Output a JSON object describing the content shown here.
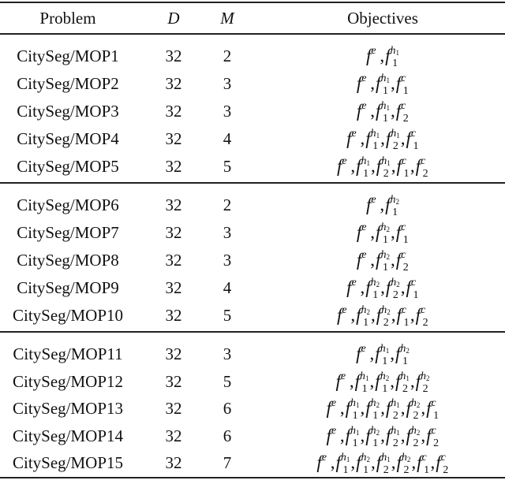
{
  "table": {
    "headers": {
      "problem": "Problem",
      "d": "D",
      "m": "M",
      "objectives": "Objectives"
    },
    "groups": [
      {
        "rows": [
          {
            "problem": "CitySeg/MOP1",
            "d": "32",
            "m": "2",
            "objectives": [
              {
                "sup": "e"
              },
              {
                "sup": "h",
                "supsub": "1",
                "sub": "1"
              }
            ]
          },
          {
            "problem": "CitySeg/MOP2",
            "d": "32",
            "m": "3",
            "objectives": [
              {
                "sup": "e"
              },
              {
                "sup": "h",
                "supsub": "1",
                "sub": "1"
              },
              {
                "sup": "c",
                "sub": "1"
              }
            ]
          },
          {
            "problem": "CitySeg/MOP3",
            "d": "32",
            "m": "3",
            "objectives": [
              {
                "sup": "e"
              },
              {
                "sup": "h",
                "supsub": "1",
                "sub": "1"
              },
              {
                "sup": "c",
                "sub": "2"
              }
            ]
          },
          {
            "problem": "CitySeg/MOP4",
            "d": "32",
            "m": "4",
            "objectives": [
              {
                "sup": "e"
              },
              {
                "sup": "h",
                "supsub": "1",
                "sub": "1"
              },
              {
                "sup": "h",
                "supsub": "1",
                "sub": "2"
              },
              {
                "sup": "c",
                "sub": "1"
              }
            ]
          },
          {
            "problem": "CitySeg/MOP5",
            "d": "32",
            "m": "5",
            "objectives": [
              {
                "sup": "e"
              },
              {
                "sup": "h",
                "supsub": "1",
                "sub": "1"
              },
              {
                "sup": "h",
                "supsub": "1",
                "sub": "2"
              },
              {
                "sup": "c",
                "sub": "1"
              },
              {
                "sup": "c",
                "sub": "2"
              }
            ]
          }
        ]
      },
      {
        "rows": [
          {
            "problem": "CitySeg/MOP6",
            "d": "32",
            "m": "2",
            "objectives": [
              {
                "sup": "e"
              },
              {
                "sup": "h",
                "supsub": "2",
                "sub": "1"
              }
            ]
          },
          {
            "problem": "CitySeg/MOP7",
            "d": "32",
            "m": "3",
            "objectives": [
              {
                "sup": "e"
              },
              {
                "sup": "h",
                "supsub": "2",
                "sub": "1"
              },
              {
                "sup": "c",
                "sub": "1"
              }
            ]
          },
          {
            "problem": "CitySeg/MOP8",
            "d": "32",
            "m": "3",
            "objectives": [
              {
                "sup": "e"
              },
              {
                "sup": "h",
                "supsub": "2",
                "sub": "1"
              },
              {
                "sup": "c",
                "sub": "2"
              }
            ]
          },
          {
            "problem": "CitySeg/MOP9",
            "d": "32",
            "m": "4",
            "objectives": [
              {
                "sup": "e"
              },
              {
                "sup": "h",
                "supsub": "2",
                "sub": "1"
              },
              {
                "sup": "h",
                "supsub": "2",
                "sub": "2"
              },
              {
                "sup": "c",
                "sub": "1"
              }
            ]
          },
          {
            "problem": "CitySeg/MOP10",
            "d": "32",
            "m": "5",
            "objectives": [
              {
                "sup": "e"
              },
              {
                "sup": "h",
                "supsub": "2",
                "sub": "1"
              },
              {
                "sup": "h",
                "supsub": "2",
                "sub": "2"
              },
              {
                "sup": "c",
                "sub": "1"
              },
              {
                "sup": "c",
                "sub": "2"
              }
            ]
          }
        ]
      },
      {
        "rows": [
          {
            "problem": "CitySeg/MOP11",
            "d": "32",
            "m": "3",
            "objectives": [
              {
                "sup": "e"
              },
              {
                "sup": "h",
                "supsub": "1",
                "sub": "1"
              },
              {
                "sup": "h",
                "supsub": "2",
                "sub": "1"
              }
            ]
          },
          {
            "problem": "CitySeg/MOP12",
            "d": "32",
            "m": "5",
            "objectives": [
              {
                "sup": "e"
              },
              {
                "sup": "h",
                "supsub": "1",
                "sub": "1"
              },
              {
                "sup": "h",
                "supsub": "2",
                "sub": "1"
              },
              {
                "sup": "h",
                "supsub": "1",
                "sub": "2"
              },
              {
                "sup": "h",
                "supsub": "2",
                "sub": "2"
              }
            ]
          },
          {
            "problem": "CitySeg/MOP13",
            "d": "32",
            "m": "6",
            "objectives": [
              {
                "sup": "e"
              },
              {
                "sup": "h",
                "supsub": "1",
                "sub": "1"
              },
              {
                "sup": "h",
                "supsub": "2",
                "sub": "1"
              },
              {
                "sup": "h",
                "supsub": "1",
                "sub": "2"
              },
              {
                "sup": "h",
                "supsub": "2",
                "sub": "2"
              },
              {
                "sup": "c",
                "sub": "1"
              }
            ]
          },
          {
            "problem": "CitySeg/MOP14",
            "d": "32",
            "m": "6",
            "objectives": [
              {
                "sup": "e"
              },
              {
                "sup": "h",
                "supsub": "1",
                "sub": "1"
              },
              {
                "sup": "h",
                "supsub": "2",
                "sub": "1"
              },
              {
                "sup": "h",
                "supsub": "1",
                "sub": "2"
              },
              {
                "sup": "h",
                "supsub": "2",
                "sub": "2"
              },
              {
                "sup": "c",
                "sub": "2"
              }
            ]
          },
          {
            "problem": "CitySeg/MOP15",
            "d": "32",
            "m": "7",
            "objectives": [
              {
                "sup": "e"
              },
              {
                "sup": "h",
                "supsub": "1",
                "sub": "1"
              },
              {
                "sup": "h",
                "supsub": "2",
                "sub": "1"
              },
              {
                "sup": "h",
                "supsub": "1",
                "sub": "2"
              },
              {
                "sup": "h",
                "supsub": "2",
                "sub": "2"
              },
              {
                "sup": "c",
                "sub": "1"
              },
              {
                "sup": "c",
                "sub": "2"
              }
            ]
          }
        ]
      }
    ]
  }
}
